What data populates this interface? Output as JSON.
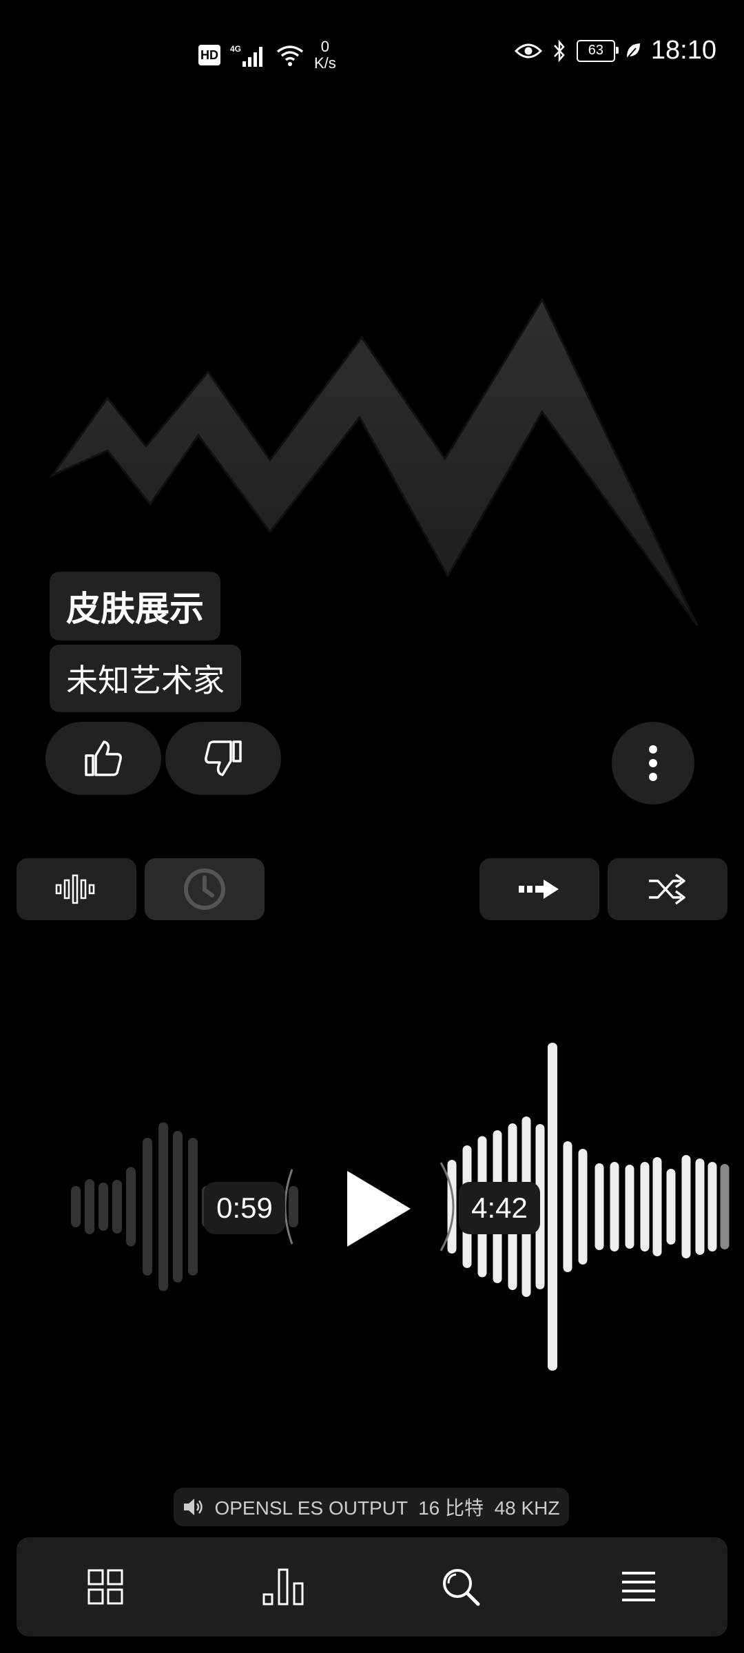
{
  "status_bar": {
    "hd": "HD",
    "net_speed_value": "0",
    "net_speed_unit": "K/s",
    "battery": "63",
    "time": "18:10"
  },
  "track": {
    "title": "皮肤展示",
    "artist": "未知艺术家"
  },
  "player": {
    "elapsed": "0:59",
    "total": "4:42",
    "progress": 0.21
  },
  "output": {
    "label": "OPENSL ES OUTPUT  16 比特  48 KHZ"
  },
  "icons": {
    "like": "thumbs-up-icon",
    "dislike": "thumbs-down-icon",
    "more": "more-vertical-icon",
    "eq": "equalizer-icon",
    "timer": "clock-icon",
    "repeat": "repeat-mode-icon",
    "shuffle": "shuffle-icon",
    "play": "play-icon",
    "speaker": "speaker-icon",
    "nav": [
      "grid-icon",
      "bar-chart-icon",
      "search-icon",
      "menu-icon"
    ]
  },
  "colors": {
    "background": "#000000",
    "pill": "#222222",
    "played_wave": "#333333",
    "unplayed_wave": "#eeeeee"
  }
}
